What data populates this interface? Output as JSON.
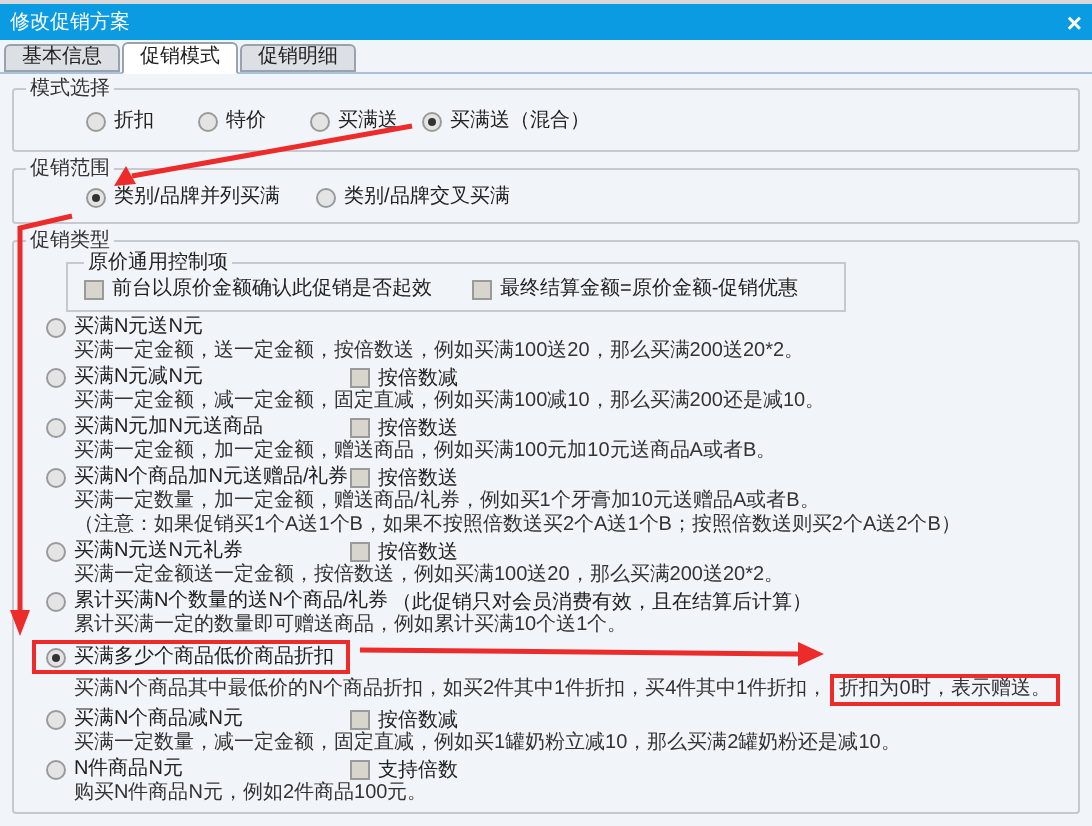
{
  "window": {
    "title": "修改促销方案",
    "close": "×"
  },
  "tabs": [
    {
      "label": "基本信息",
      "selected": false
    },
    {
      "label": "促销模式",
      "selected": true
    },
    {
      "label": "促销明细",
      "selected": false
    }
  ],
  "mode_selection": {
    "label": "模式选择",
    "options": [
      {
        "label": "折扣",
        "selected": false
      },
      {
        "label": "特价",
        "selected": false
      },
      {
        "label": "买满送",
        "selected": false
      },
      {
        "label": "买满送（混合）",
        "selected": true
      }
    ]
  },
  "scope": {
    "label": "促销范围",
    "options": [
      {
        "label": "类别/品牌并列买满",
        "selected": true
      },
      {
        "label": "类别/品牌交叉买满",
        "selected": false
      }
    ]
  },
  "promotion_type": {
    "label": "促销类型",
    "original_price_control": {
      "label": "原价通用控制项",
      "checkboxes": [
        {
          "label": "前台以原价金额确认此促销是否起效",
          "checked": false
        },
        {
          "label": "最终结算金额=原价金额-促销优惠",
          "checked": false
        }
      ]
    },
    "options": [
      {
        "label": "买满N元送N元",
        "selected": false,
        "description": [
          "买满一定金额，送一定金额，按倍数送，例如买满100送20，那么买满200送20*2。"
        ]
      },
      {
        "label": "买满N元减N元",
        "selected": false,
        "checkbox": {
          "label": "按倍数减",
          "checked": false
        },
        "description": [
          "买满一定金额，减一定金额，固定直减，例如买满100减10，那么买满200还是减10。"
        ]
      },
      {
        "label": "买满N元加N元送商品",
        "selected": false,
        "checkbox": {
          "label": "按倍数送",
          "checked": false
        },
        "description": [
          "买满一定金额，加一定金额，赠送商品，例如买满100元加10元送商品A或者B。"
        ]
      },
      {
        "label": "买满N个商品加N元送赠品/礼券",
        "selected": false,
        "checkbox": {
          "label": "按倍数送",
          "checked": false
        },
        "description": [
          "买满一定数量，加一定金额，赠送商品/礼券，例如买1个牙膏加10元送赠品A或者B。",
          "（注意：如果促销买1个A送1个B，如果不按照倍数送买2个A送1个B；按照倍数送则买2个A送2个B）"
        ]
      },
      {
        "label": "买满N元送N元礼券",
        "selected": false,
        "checkbox": {
          "label": "按倍数送",
          "checked": false
        },
        "description": [
          "买满一定金额送一定金额，按倍数送，例如买满100送20，那么买满200送20*2。"
        ]
      },
      {
        "label": "累计买满N个数量的送N个商品/礼券",
        "selected": false,
        "note": "（此促销只对会员消费有效，且在结算后计算）",
        "description": [
          "累计买满一定的数量即可赠送商品，例如累计买满10个送1个。"
        ]
      },
      {
        "label": "买满多少个商品低价商品折扣",
        "selected": true,
        "highlighted": true,
        "description": [
          "买满N个商品其中最低价的N个商品折扣，如买2件其中1件折扣，买4件其中1件折扣，"
        ],
        "highlighted_text": "折扣为0时，表示赠送。"
      },
      {
        "label": "买满N个商品减N元",
        "selected": false,
        "checkbox": {
          "label": "按倍数减",
          "checked": false
        },
        "description": [
          "买满一定数量，减一定金额，固定直减，例如买1罐奶粉立减10，那么买满2罐奶粉还是减10。"
        ]
      },
      {
        "label": "N件商品N元",
        "selected": false,
        "checkbox": {
          "label": "支持倍数",
          "checked": false
        },
        "description": [
          "购买N件商品N元，例如2件商品100元。"
        ]
      }
    ]
  }
}
